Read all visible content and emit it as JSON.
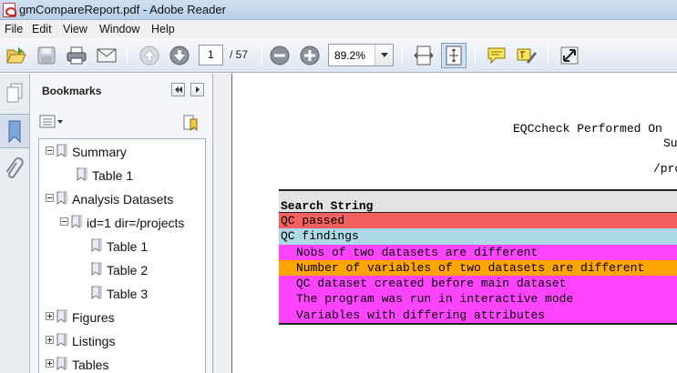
{
  "window": {
    "title": "gmCompareReport.pdf - Adobe Reader"
  },
  "menu": [
    "File",
    "Edit",
    "View",
    "Window",
    "Help"
  ],
  "toolbar": {
    "page_current": "1",
    "page_total": "/ 57",
    "zoom": "89.2%",
    "icons": [
      "open-icon",
      "save-icon",
      "print-icon",
      "email-icon",
      "prev-page-icon",
      "next-page-icon",
      "zoom-out-icon",
      "zoom-in-icon",
      "fit-width-icon",
      "fit-page-icon",
      "comment-icon",
      "highlight-icon",
      "fullscreen-icon"
    ]
  },
  "bookmarks_panel": {
    "title": "Bookmarks",
    "items": [
      {
        "label": "Summary",
        "level": 0,
        "expander": "minus"
      },
      {
        "label": "Table 1",
        "level": 1,
        "expander": "none"
      },
      {
        "label": "Analysis Datasets",
        "level": 0,
        "expander": "minus"
      },
      {
        "label": "id=1 dir=/projects",
        "level": 1,
        "expander": "minus"
      },
      {
        "label": "Table 1",
        "level": 2,
        "expander": "none"
      },
      {
        "label": "Table 2",
        "level": 2,
        "expander": "none"
      },
      {
        "label": "Table 3",
        "level": 2,
        "expander": "none"
      },
      {
        "label": "Figures",
        "level": 0,
        "expander": "plus"
      },
      {
        "label": "Listings",
        "level": 0,
        "expander": "plus"
      },
      {
        "label": "Tables",
        "level": 0,
        "expander": "plus"
      }
    ]
  },
  "document": {
    "header_line1": "EQCcheck Performed On",
    "header_line2": "Su",
    "header_line3": "/pro",
    "table": {
      "column_header": "Search String",
      "rows": [
        {
          "text": "QC passed",
          "indent": false,
          "color": "#f26060"
        },
        {
          "text": "QC findings",
          "indent": false,
          "color": "#add8e6"
        },
        {
          "text": "Nobs of two datasets are different",
          "indent": true,
          "color": "#ff44ff"
        },
        {
          "text": "Number of variables of two datasets are different",
          "indent": true,
          "color": "#ffa500"
        },
        {
          "text": "QC dataset created before main dataset",
          "indent": true,
          "color": "#ff44ff"
        },
        {
          "text": "The program was run in interactive mode",
          "indent": true,
          "color": "#ff44ff"
        },
        {
          "text": "Variables with differing attributes",
          "indent": true,
          "color": "#ff44ff"
        }
      ]
    }
  }
}
